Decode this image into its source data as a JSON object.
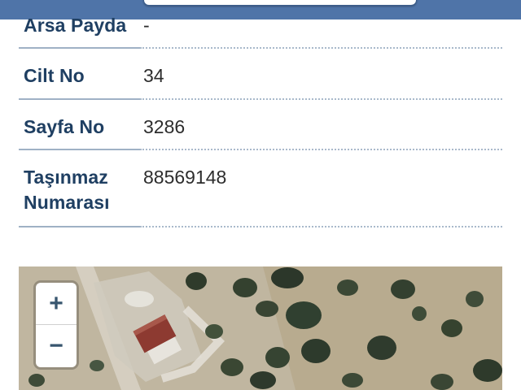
{
  "rows": [
    {
      "label": "Arsa Payda",
      "value": "-"
    },
    {
      "label": "Cilt No",
      "value": "34"
    },
    {
      "label": "Sayfa No",
      "value": "3286"
    },
    {
      "label": "Taşınmaz Numarası",
      "value": "88569148"
    }
  ],
  "map": {
    "zoom_in_label": "+",
    "zoom_out_label": "−"
  },
  "colors": {
    "header_bar": "#4f74a8",
    "label_text": "#1f3f62",
    "value_text": "#2d2d2d"
  }
}
